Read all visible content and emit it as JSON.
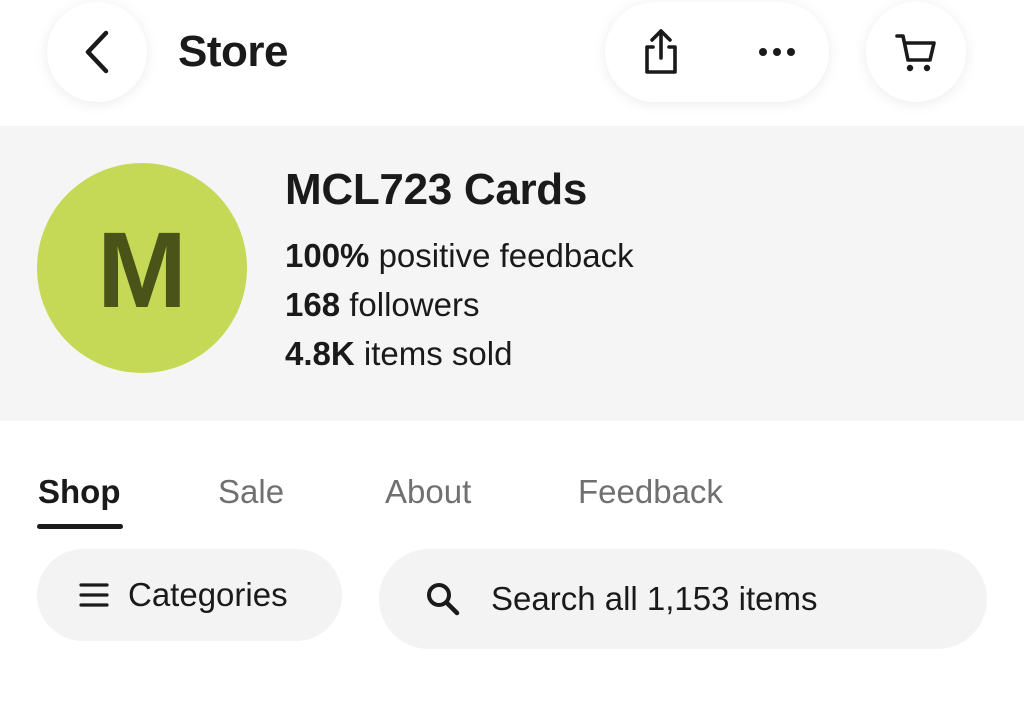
{
  "header": {
    "title": "Store",
    "icons": {
      "back": "chevron-left-icon",
      "share": "share-icon",
      "more": "more-horizontal-icon",
      "cart": "cart-icon"
    }
  },
  "store": {
    "avatar_letter": "M",
    "avatar_color": "#c5d957",
    "name": "MCL723 Cards",
    "stats": [
      {
        "value": "100%",
        "label": "positive feedback"
      },
      {
        "value": "168",
        "label": "followers"
      },
      {
        "value": "4.8K",
        "label": "items sold"
      }
    ]
  },
  "tabs": [
    {
      "label": "Shop",
      "active": true
    },
    {
      "label": "Sale",
      "active": false
    },
    {
      "label": "About",
      "active": false
    },
    {
      "label": "Feedback",
      "active": false
    }
  ],
  "actions": {
    "categories_label": "Categories",
    "search_placeholder": "Search all 1,153 items"
  }
}
